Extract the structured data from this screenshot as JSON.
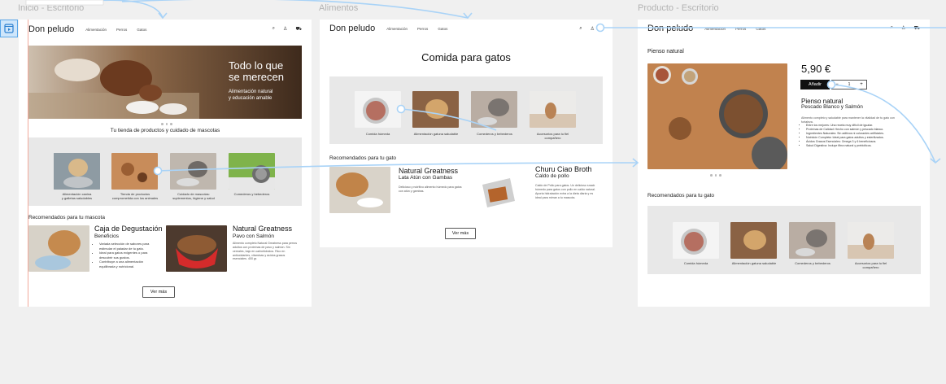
{
  "frames": {
    "inicio": {
      "label": "Inicio - Escritorio"
    },
    "alimentos": {
      "label": "Alimentos"
    },
    "producto": {
      "label": "Producto - Escritorio"
    }
  },
  "header": {
    "logo": "Don peludo",
    "nav": [
      "Alimentación",
      "Perros",
      "Gatos"
    ]
  },
  "inicio": {
    "hero_title_1": "Todo lo que",
    "hero_title_2": "se merecen",
    "hero_sub_1": "Alimentación natural",
    "hero_sub_2": "y educación amable",
    "tagline": "Tu tienda de productos y cuidado de mascotas",
    "categories": [
      {
        "label_1": "Alimentación canina",
        "label_2": "y galletas saludables"
      },
      {
        "label_1": "Tienda de productos",
        "label_2": "comprometida con los animales"
      },
      {
        "label_1": "Cuidado de mascotas:",
        "label_2": "suplementos, higiene y salud"
      },
      {
        "label_1": "Comederos y bebederos",
        "label_2": ""
      }
    ],
    "recommended_title": "Recomendados para tu mascota",
    "product1": {
      "name": "Caja de Degustación",
      "sub": "Beneficios",
      "bullets": [
        "Variada selección de sabores para estimular el paladar de tu gato.",
        "Ideal para gatos exigentes o para descubrir sus gustos.",
        "Contribuye a una alimentación equilibrada y nutricional."
      ]
    },
    "product2": {
      "name": "Natural Greatness",
      "sub": "Pavo con Salmón",
      "desc": "Alimento completo Natural Greatness para perros adultos con proteínas de pavo y salmón. Sin cereales, bajo en carbohidratos. Rico en antioxidantes, vitaminas y ácidos grasos esenciales. 400 gr."
    },
    "more_button": "Ver más"
  },
  "alimentos": {
    "title": "Comida para gatos",
    "categories": [
      {
        "label_1": "Comida húmeda",
        "label_2": ""
      },
      {
        "label_1": "Alimentación gatuna saludable",
        "label_2": ""
      },
      {
        "label_1": "Comederos y bebederos",
        "label_2": ""
      },
      {
        "label_1": "Accesorios para tu fiel",
        "label_2": "compañero"
      }
    ],
    "recommended_title": "Recomendados para tu gato",
    "product1": {
      "name": "Natural Greatness",
      "sub": "Lata Atún con Gambas",
      "desc": "Delicioso y nutritivo alimento húmedo para gatos con atún y gambas."
    },
    "product2": {
      "name": "Churu Ciao Broth",
      "sub": "Caldo de pollo",
      "desc": "Caldo de Pollo para gatos. Un delicioso snack húmedo para gatos con pollo en caldo natural. Aporta hidratación extra a la dieta diaria y es ideal para mimar a tu mascota."
    },
    "more_button": "Ver más"
  },
  "producto": {
    "title": "Pienso natural",
    "price": "5,90 €",
    "add_button": "Añadir",
    "minus": "−",
    "qty": "1",
    "plus": "+",
    "name": "Pienso natural",
    "sub": "Pescado Blanco y Salmón",
    "desc": "Alimento completo y saludable para mantener la vitalidad de tu gato con fortaleza.",
    "bullets": [
      "Entre los mejores: Una receta muy difícil de igualar.",
      "Proteínas de Calidad: Hecho con salmón y pescado blanco.",
      "Ingredientes Naturales: Sin aditivos ni colorantes artificiales.",
      "Nutrición Completa: Ideal para gatos adultos y esterilizados.",
      "Ácidos Grasos Esenciales: Omega 3 y 6 beneficiosos.",
      "Salud Digestiva: Incluye fibra natural y prebióticos."
    ],
    "recommended_title": "Recomendados para tu gato",
    "categories": [
      {
        "label_1": "Comida húmeda",
        "label_2": ""
      },
      {
        "label_1": "Alimentación gatuna saludable",
        "label_2": ""
      },
      {
        "label_1": "Comederos y bebederos",
        "label_2": ""
      },
      {
        "label_1": "Accesorios para tu fiel",
        "label_2": "compañero"
      }
    ]
  },
  "colors": {
    "canvas": "#f0f0f0",
    "frame": "#ffffff",
    "grey_band": "#e8e8e8",
    "prototype_link": "#a9d3f7",
    "dark_button": "#111111"
  }
}
